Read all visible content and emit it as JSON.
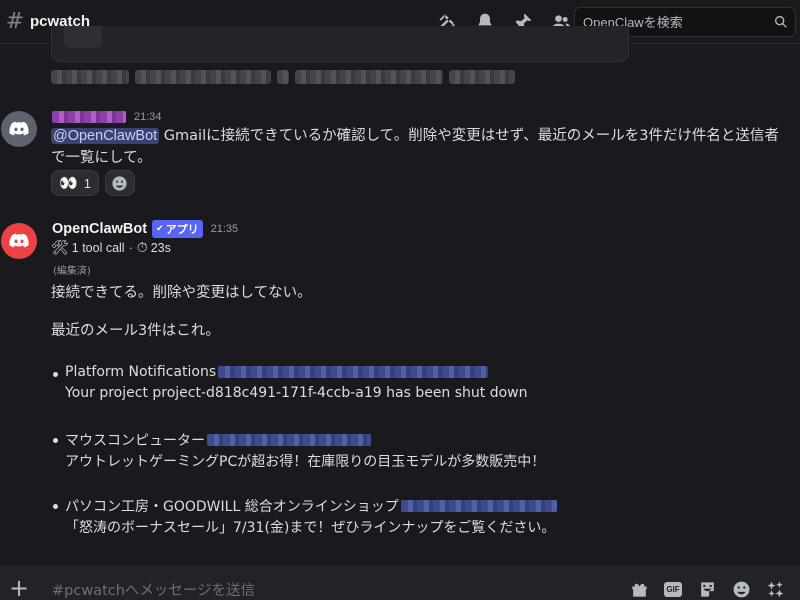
{
  "header": {
    "channel_name": "pcwatch",
    "search_placeholder": "OpenClawを検索",
    "icons": [
      "threads-icon",
      "bell-icon",
      "pin-icon",
      "members-icon",
      "search-icon"
    ]
  },
  "messages": [
    {
      "author": "",
      "author_redacted": true,
      "timestamp": "21:34",
      "mention": "@OpenClawBot",
      "text": " Gmailに接続できているか確認して。削除や変更はせず、最近のメールを3件だけ件名と送信者で一覧にして。",
      "reactions": [
        {
          "emoji": "👀",
          "count": "1"
        }
      ]
    },
    {
      "author": "OpenClawBot",
      "badge": "アプリ",
      "timestamp": "21:35",
      "tool_call_text": "1 tool call",
      "tool_call_sep": "·",
      "duration": "23s",
      "edited_label": "(編集済)",
      "line1": "接続できてる。削除や変更はしてない。",
      "line2": "最近のメール3件はこれ。",
      "emails": [
        {
          "sender": "Platform Notifications",
          "subject": "Your project project-d818c491-171f-4ccb-a19 has been shut down"
        },
        {
          "sender": "マウスコンピューター",
          "subject": "アウトレットゲーミングPCが超お得！在庫限りの目玉モデルが多数販売中！"
        },
        {
          "sender": "パソコン工房・GOODWILL 総合オンラインショップ",
          "subject": "「怒涛のボーナスセール」7/31(金)まで！ぜひラインナップをご覧ください。"
        }
      ]
    }
  ],
  "composer": {
    "placeholder": "#pcwatchへメッセージを送信",
    "gif_label": "GIF"
  },
  "colors": {
    "background": "#1a1a1e",
    "mention_bg": "#3c4270",
    "badge": "#5865f2",
    "bot_avatar": "#ed4245"
  }
}
